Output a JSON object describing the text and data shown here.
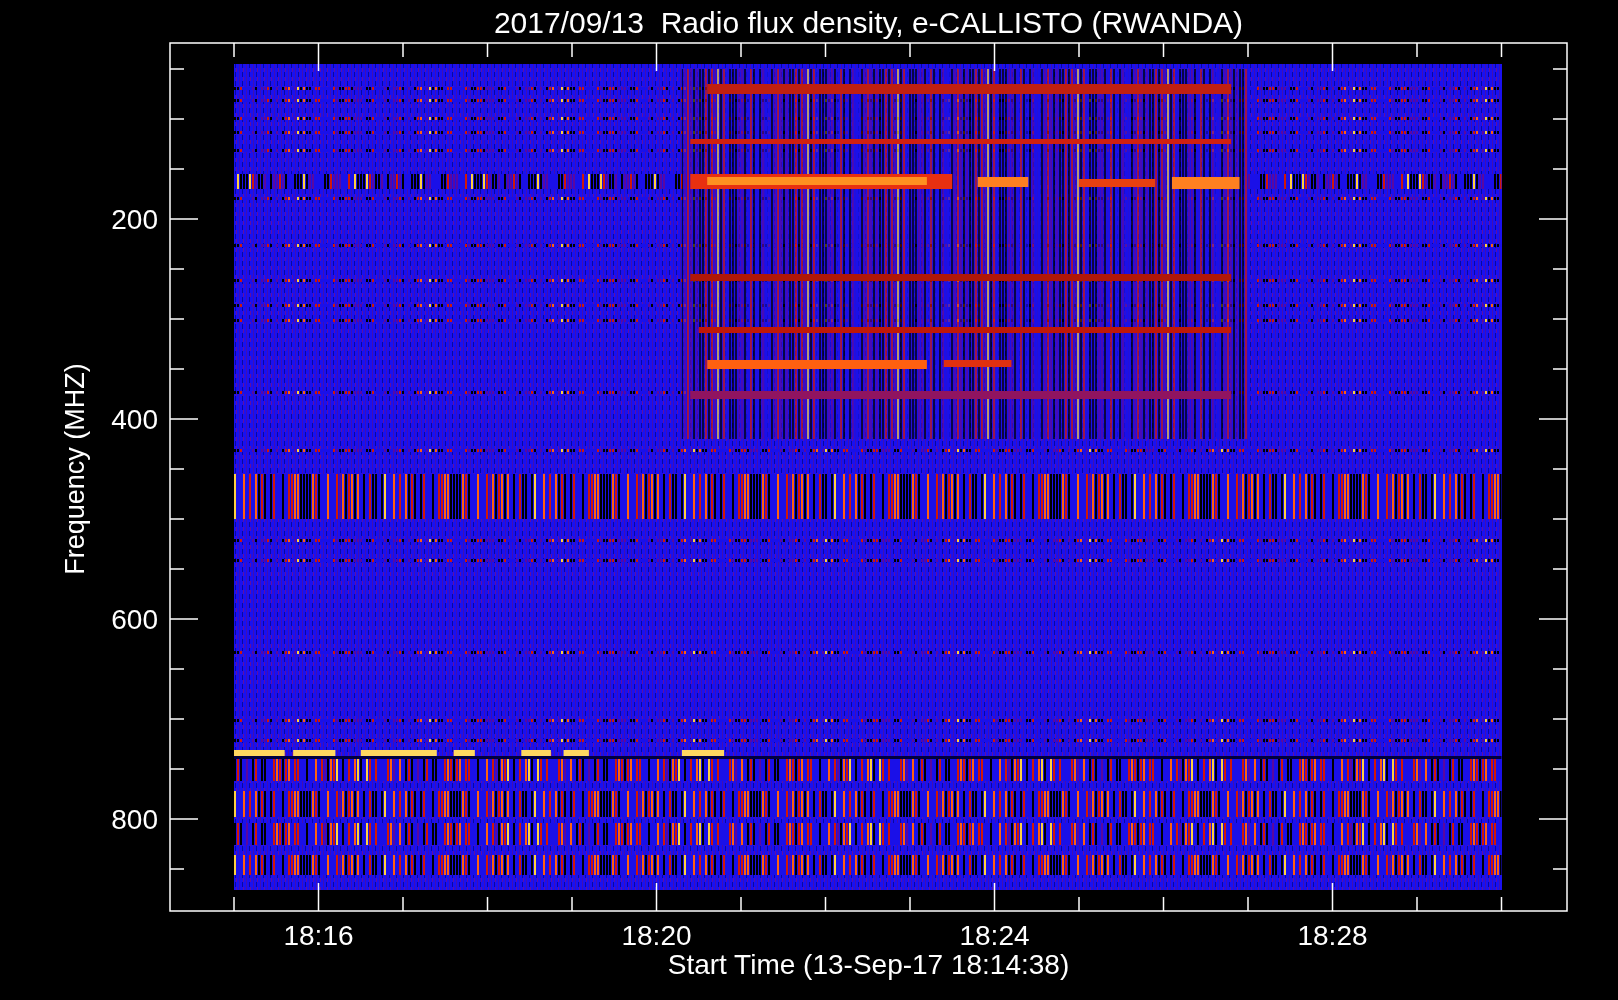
{
  "title": "2017/09/13  Radio flux density, e-CALLISTO (RWANDA)",
  "y_axis": {
    "label": "Frequency (MHZ)",
    "ticks": [
      "200",
      "400",
      "600",
      "800"
    ]
  },
  "x_axis": {
    "label": "Start Time (13-Sep-17 18:14:38)",
    "ticks": [
      "18:16",
      "18:20",
      "18:24",
      "18:28"
    ]
  }
}
